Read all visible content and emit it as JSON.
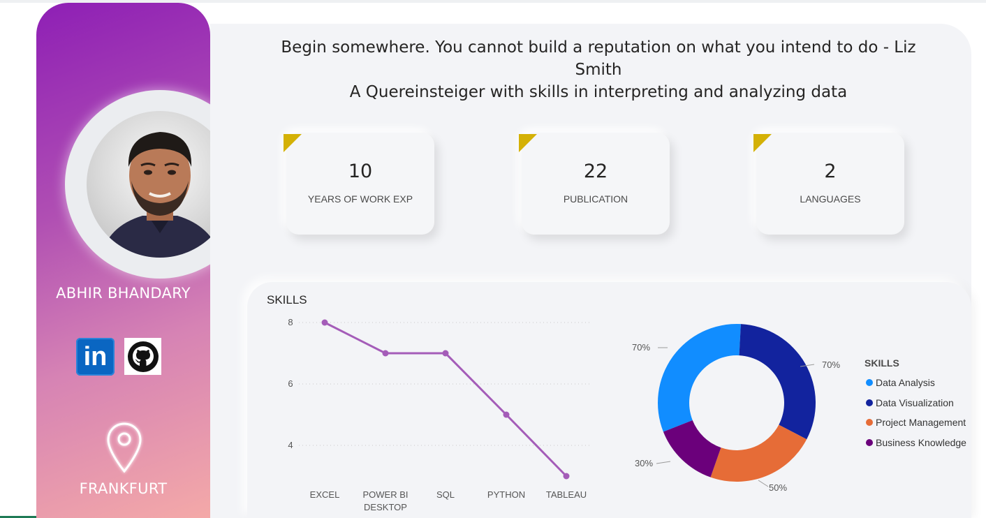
{
  "sidebar": {
    "name": "ABHIR BHANDARY",
    "social": {
      "linkedin_glyph": "in",
      "linkedin_icon": "linkedin-icon",
      "github_icon": "github-icon"
    },
    "location_icon": "location-pin-icon",
    "location": "FRANKFURT",
    "gradient": [
      "#8e1fb5",
      "#b04fb3",
      "#d683b4",
      "#f4a9a8"
    ]
  },
  "header": {
    "quote": "Begin somewhere. You cannot build a reputation on what you intend to do - Liz Smith",
    "tagline": "A Quereinsteiger with skills in interpreting and analyzing data"
  },
  "kpis": [
    {
      "value": "10",
      "label": "YEARS OF WORK EXP"
    },
    {
      "value": "22",
      "label": "PUBLICATION"
    },
    {
      "value": "2",
      "label": "LANGUAGES"
    }
  ],
  "kpi_accent": "#d4b106",
  "skills_title": "SKILLS",
  "chart_data": [
    {
      "type": "line",
      "categories": [
        "EXCEL",
        "POWER BI DESKTOP",
        "SQL",
        "PYTHON",
        "TABLEAU"
      ],
      "values": [
        8,
        7,
        7,
        5,
        3
      ],
      "yticks": [
        "8",
        "6",
        "4"
      ],
      "ylim": [
        3,
        8
      ],
      "grid": true,
      "color": "#a45cb8"
    },
    {
      "type": "pie",
      "donut": true,
      "legend_title": "SKILLS",
      "legend_position": "right",
      "labels": [
        "Data Analysis",
        "Data Visualization",
        "Project Management",
        "Business Knowledge"
      ],
      "values": [
        70,
        70,
        50,
        30
      ],
      "data_labels": [
        "70%",
        "70%",
        "50%",
        "30%"
      ],
      "colors": [
        "#118dff",
        "#12239e",
        "#e66c37",
        "#6b007b"
      ]
    }
  ]
}
